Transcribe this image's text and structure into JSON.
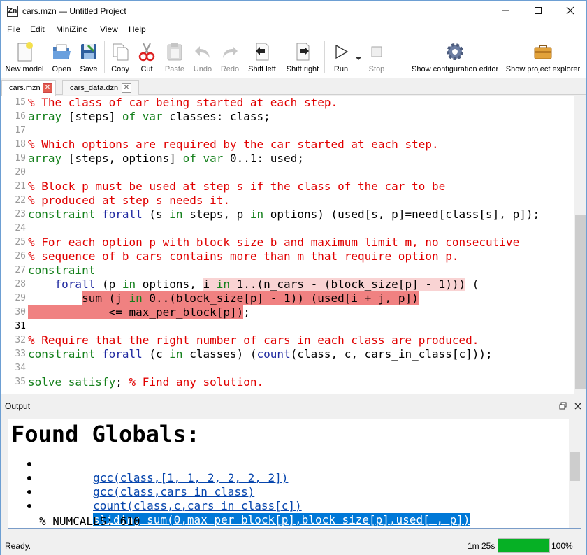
{
  "window": {
    "title": "cars.mzn — Untitled Project",
    "icon_text": "Zn"
  },
  "menu": [
    "File",
    "Edit",
    "MiniZinc",
    "View",
    "Help"
  ],
  "toolbar": {
    "new_model": "New model",
    "open": "Open",
    "save": "Save",
    "copy": "Copy",
    "cut": "Cut",
    "paste": "Paste",
    "undo": "Undo",
    "redo": "Redo",
    "shift_left": "Shift left",
    "shift_right": "Shift right",
    "run": "Run",
    "stop": "Stop",
    "config_editor": "Show configuration editor",
    "project_explorer": "Show project explorer"
  },
  "tabs": [
    {
      "label": "cars.mzn",
      "active": true
    },
    {
      "label": "cars_data.dzn",
      "active": false
    }
  ],
  "editor": {
    "current_line": 31,
    "lines": [
      {
        "n": "15",
        "parts": [
          [
            "cm",
            "% The class of car being started at each step."
          ]
        ]
      },
      {
        "n": "16",
        "parts": [
          [
            "kw",
            "array"
          ],
          [
            "id",
            " [steps] "
          ],
          [
            "kw",
            "of var"
          ],
          [
            "id",
            " classes: class;"
          ]
        ]
      },
      {
        "n": "17",
        "parts": []
      },
      {
        "n": "18",
        "parts": [
          [
            "cm",
            "% Which options are required by the car started at each step."
          ]
        ]
      },
      {
        "n": "19",
        "parts": [
          [
            "kw",
            "array"
          ],
          [
            "id",
            " [steps, options] "
          ],
          [
            "kw",
            "of var"
          ],
          [
            "id",
            " 0..1: used;"
          ]
        ]
      },
      {
        "n": "20",
        "parts": []
      },
      {
        "n": "21",
        "parts": [
          [
            "cm",
            "% Block p must be used at step s if the class of the car to be"
          ]
        ]
      },
      {
        "n": "22",
        "parts": [
          [
            "cm",
            "% produced at step s needs it."
          ]
        ]
      },
      {
        "n": "23",
        "parts": [
          [
            "kw",
            "constraint"
          ],
          [
            "id",
            " "
          ],
          [
            "fn",
            "forall"
          ],
          [
            "id",
            " (s "
          ],
          [
            "kw",
            "in"
          ],
          [
            "id",
            " steps, p "
          ],
          [
            "kw",
            "in"
          ],
          [
            "id",
            " options) (used[s, p]=need[class[s], p]);"
          ]
        ]
      },
      {
        "n": "24",
        "parts": []
      },
      {
        "n": "25",
        "parts": [
          [
            "cm",
            "% For each option p with block size b and maximum limit m, no consecutive"
          ]
        ]
      },
      {
        "n": "26",
        "parts": [
          [
            "cm",
            "% sequence of b cars contains more than m that require option p."
          ]
        ]
      },
      {
        "n": "27",
        "parts": [
          [
            "kw",
            "constraint"
          ]
        ]
      },
      {
        "n": "28",
        "parts": [
          [
            "id",
            "    "
          ],
          [
            "fn",
            "forall"
          ],
          [
            "id",
            " (p "
          ],
          [
            "kw",
            "in"
          ],
          [
            "id",
            " options, "
          ],
          [
            "id hl-light",
            "i "
          ],
          [
            "kw hl-light",
            "in"
          ],
          [
            "id hl-light",
            " 1..(n_cars - (block_size[p] - 1)))"
          ],
          [
            "id",
            " ("
          ]
        ]
      },
      {
        "n": "29",
        "parts": [
          [
            "id",
            "        "
          ],
          [
            "id hl-strong",
            "sum (j "
          ],
          [
            "kw hl-strong",
            "in"
          ],
          [
            "id hl-strong",
            " 0..(block_size[p] - 1)) (used[i + j, p])"
          ]
        ]
      },
      {
        "n": "30",
        "parts": [
          [
            "id hl-strong",
            "            <= max_per_block[p])"
          ],
          [
            "id",
            ";"
          ]
        ]
      },
      {
        "n": "31",
        "parts": []
      },
      {
        "n": "32",
        "parts": [
          [
            "cm",
            "% Require that the right number of cars in each class are produced."
          ]
        ]
      },
      {
        "n": "33",
        "parts": [
          [
            "kw",
            "constraint"
          ],
          [
            "id",
            " "
          ],
          [
            "fn",
            "forall"
          ],
          [
            "id",
            " (c "
          ],
          [
            "kw",
            "in"
          ],
          [
            "id",
            " classes) ("
          ],
          [
            "fn",
            "count"
          ],
          [
            "id",
            "(class, c, cars_in_class[c]));"
          ]
        ]
      },
      {
        "n": "34",
        "parts": []
      },
      {
        "n": "35",
        "parts": [
          [
            "kw",
            "solve satisfy"
          ],
          [
            "id",
            "; "
          ],
          [
            "cm",
            "% Find any solution."
          ]
        ]
      }
    ]
  },
  "output": {
    "title": "Output",
    "heading": "Found Globals:",
    "items": [
      {
        "text": "gcc(class,[1, 1, 2, 2, 2, 2])",
        "selected": false
      },
      {
        "text": "gcc(class,cars_in_class)",
        "selected": false
      },
      {
        "text": "count(class,c,cars_in_class[c])",
        "selected": false
      },
      {
        "text": "sliding_sum(0,max_per_block[p],block_size[p],used[_, p])",
        "selected": true
      }
    ],
    "numcalls": "% NUMCALLS: 610"
  },
  "status": {
    "text": "Ready.",
    "elapsed": "1m 25s",
    "progress_fraction": 1.0,
    "percent": "100%"
  },
  "colors": {
    "comment": "#e00000",
    "keyword": "#15801c",
    "function": "#1f29a0",
    "progress": "#06b025",
    "selection": "#0078d7"
  }
}
